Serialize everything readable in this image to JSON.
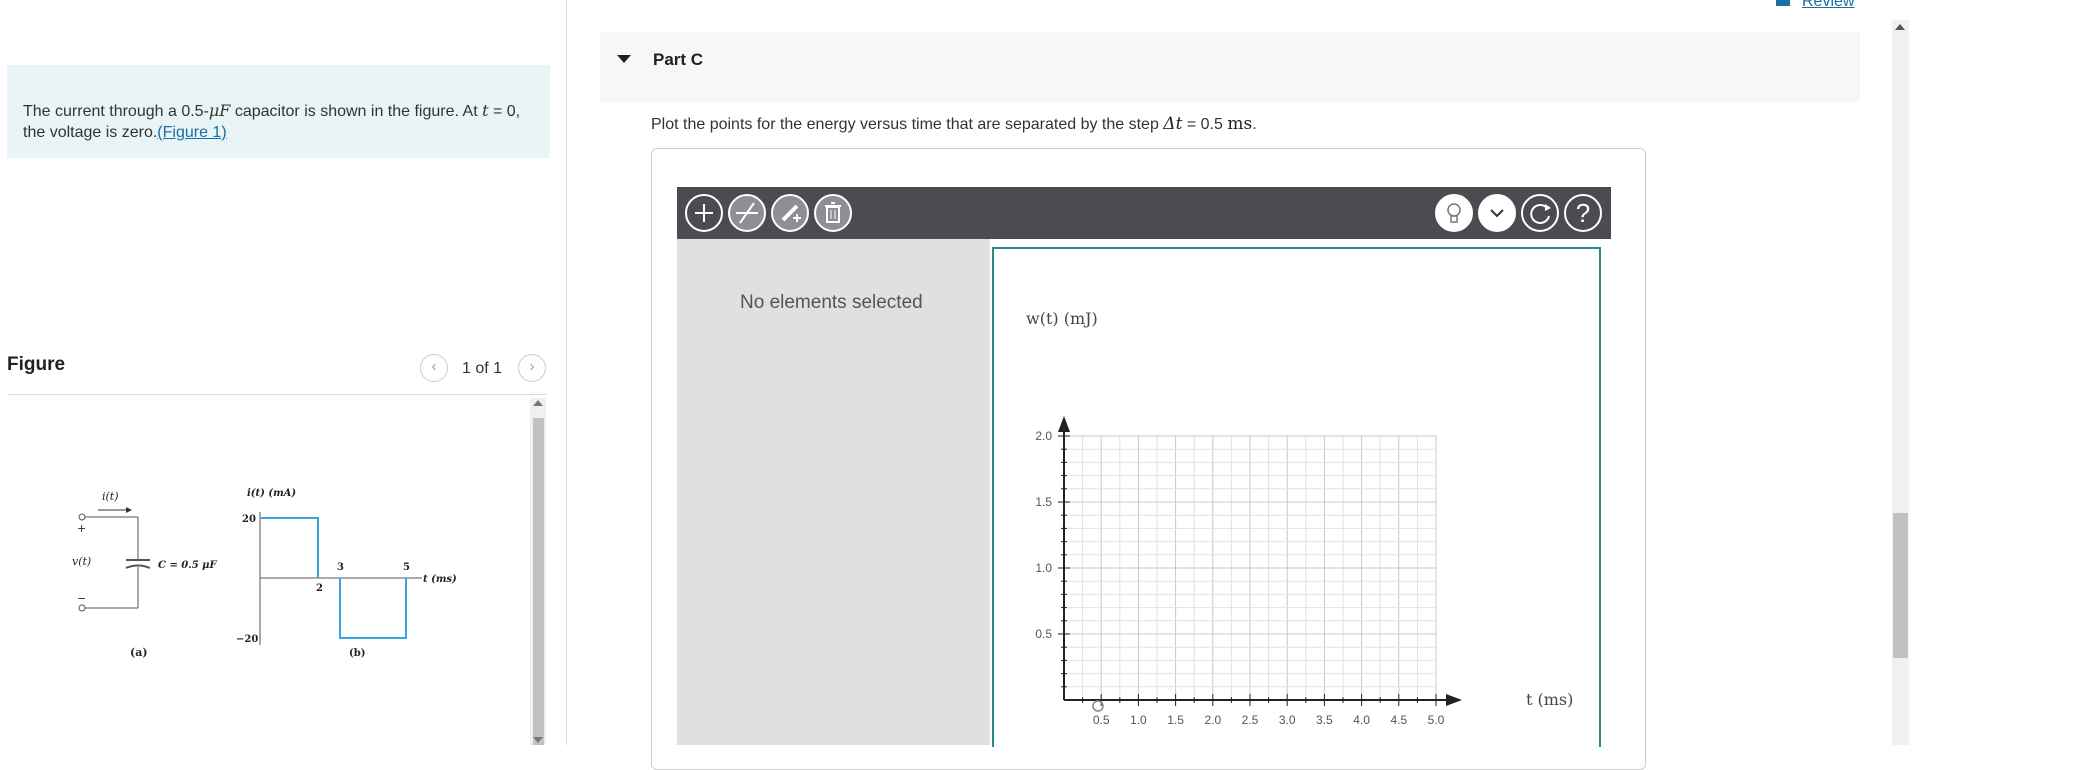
{
  "review": {
    "label": "Review"
  },
  "problem": {
    "text_before": "The current through a 0.5-",
    "unit_mu": "μF",
    "text_mid": " capacitor is shown in the figure. At ",
    "t_symbol": "t",
    "text_after": " = 0, the voltage is zero.",
    "figure_link": "(Figure 1)"
  },
  "figure": {
    "title": "Figure",
    "counter": "1 of 1",
    "prev_icon": "chevron-left-icon",
    "next_icon": "chevron-right-icon",
    "circuit": {
      "current_label": "i(t)",
      "voltage_label": "v(t)",
      "plus": "+",
      "minus": "−",
      "capacitor_label": "C = 0.5 μF",
      "caption": "(a)"
    },
    "waveform": {
      "ylabel": "i(t) (mA)",
      "xlabel": "t (ms)",
      "y_top": "20",
      "y_bottom": "−20",
      "tick_2": "2",
      "tick_3": "3",
      "tick_5": "5",
      "caption": "(b)"
    }
  },
  "part": {
    "title": "Part C",
    "instruction_before": "Plot the points for the energy versus time that are separated by the step ",
    "delta_t": "Δt",
    "instruction_eq": " = 0.5 ",
    "instruction_unit": "ms",
    "instruction_end": "."
  },
  "toolbar": {
    "add_icon": "plus-icon",
    "line_icon": "line-tool-icon",
    "edit_icon": "edit-icon",
    "delete_icon": "trash-icon",
    "hint_icon": "lightbulb-icon",
    "dropdown_icon": "chevron-down-icon",
    "reset_icon": "reset-icon",
    "help_label": "?"
  },
  "side_panel": {
    "status": "No elements selected"
  },
  "chart_data": {
    "type": "scatter",
    "ylabel": "w(t) (mJ)",
    "xlabel": "t (ms)",
    "xlim": [
      0,
      5.0
    ],
    "ylim": [
      0,
      2.0
    ],
    "x_ticks": [
      "0.5",
      "1.0",
      "1.5",
      "2.0",
      "2.5",
      "3.0",
      "3.5",
      "4.0",
      "4.5",
      "5.0"
    ],
    "y_ticks": [
      "0.5",
      "1.0",
      "1.5",
      "2.0"
    ],
    "grid": true,
    "points": [
      {
        "x": 0,
        "y": 0
      }
    ]
  }
}
